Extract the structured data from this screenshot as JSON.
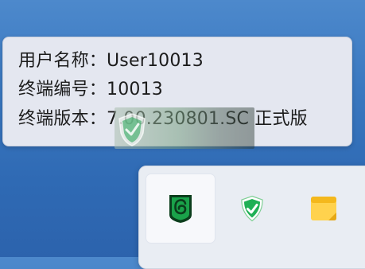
{
  "tooltip": {
    "line1": "用户名称：User10013",
    "line2": "终端编号：10013",
    "line3": "终端版本：7.00.230801.SC 正式版"
  },
  "tray": {
    "items": [
      {
        "icon": "green-shield-app-icon",
        "selected": true
      },
      {
        "icon": "security-shield-icon",
        "selected": false
      },
      {
        "icon": "sticky-notes-icon",
        "selected": false
      }
    ]
  },
  "colors": {
    "desktop_blue": "#3a78c0",
    "tooltip_bg": "#e4e7f0",
    "flyout_bg": "#e9edf3",
    "shield_green": "#1aa24a"
  }
}
